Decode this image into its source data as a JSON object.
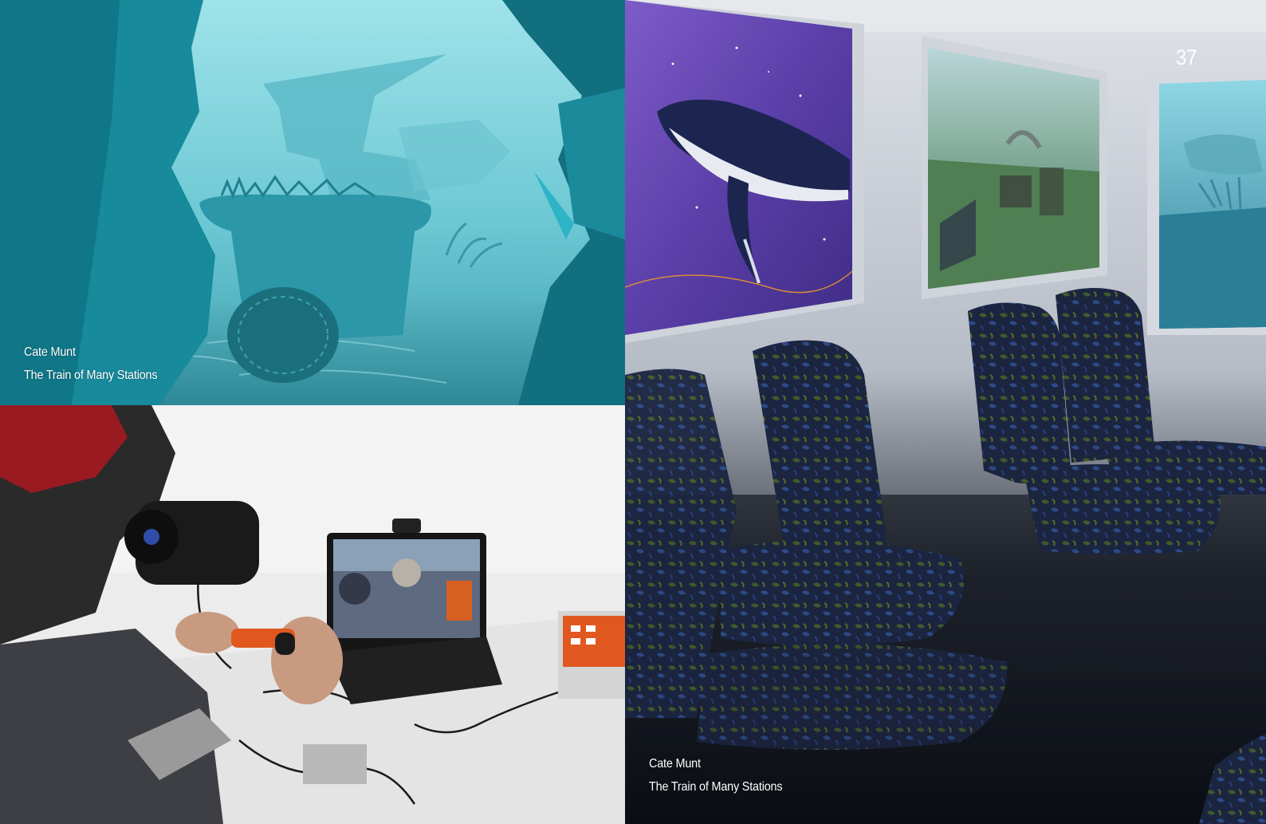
{
  "page": {
    "number": "37"
  },
  "photos": {
    "underwater": {
      "caption": {
        "artist": "Cate Munt",
        "title": "The Train of Many Stations"
      }
    },
    "vr_user": {},
    "train_carriage": {
      "caption": {
        "artist": "Cate Munt",
        "title": "The Train of Many Stations"
      }
    }
  },
  "palette": {
    "underwater_water": "#7fd3dd",
    "underwater_rock": "#1f9aab",
    "carriage_wall": "#c9cdd6",
    "seat_fabric": "#1b2540",
    "whale_panel": "#6a4bb8"
  }
}
